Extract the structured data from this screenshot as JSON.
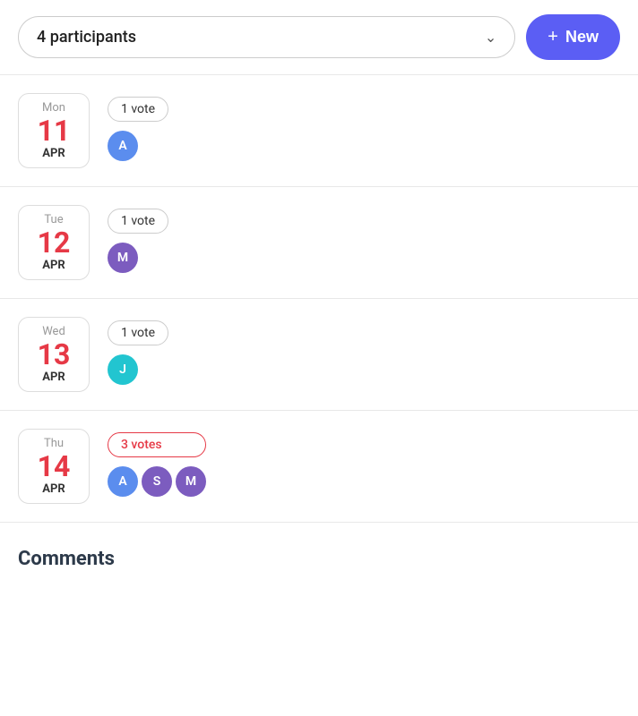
{
  "header": {
    "participants_label": "4 participants",
    "new_button_label": "New"
  },
  "dates": [
    {
      "id": "mon-11",
      "day_name": "Mon",
      "day_number": "11",
      "month": "APR",
      "vote_count": "1 vote",
      "highlighted": false,
      "avatars": [
        {
          "letter": "A",
          "color_class": "avatar-a"
        }
      ]
    },
    {
      "id": "tue-12",
      "day_name": "Tue",
      "day_number": "12",
      "month": "APR",
      "vote_count": "1 vote",
      "highlighted": false,
      "avatars": [
        {
          "letter": "M",
          "color_class": "avatar-m"
        }
      ]
    },
    {
      "id": "wed-13",
      "day_name": "Wed",
      "day_number": "13",
      "month": "APR",
      "vote_count": "1 vote",
      "highlighted": false,
      "avatars": [
        {
          "letter": "J",
          "color_class": "avatar-j"
        }
      ]
    },
    {
      "id": "thu-14",
      "day_name": "Thu",
      "day_number": "14",
      "month": "APR",
      "vote_count": "3 votes",
      "highlighted": true,
      "avatars": [
        {
          "letter": "A",
          "color_class": "avatar-a"
        },
        {
          "letter": "S",
          "color_class": "avatar-s"
        },
        {
          "letter": "M",
          "color_class": "avatar-m2"
        }
      ]
    }
  ],
  "comments": {
    "heading": "Comments"
  }
}
